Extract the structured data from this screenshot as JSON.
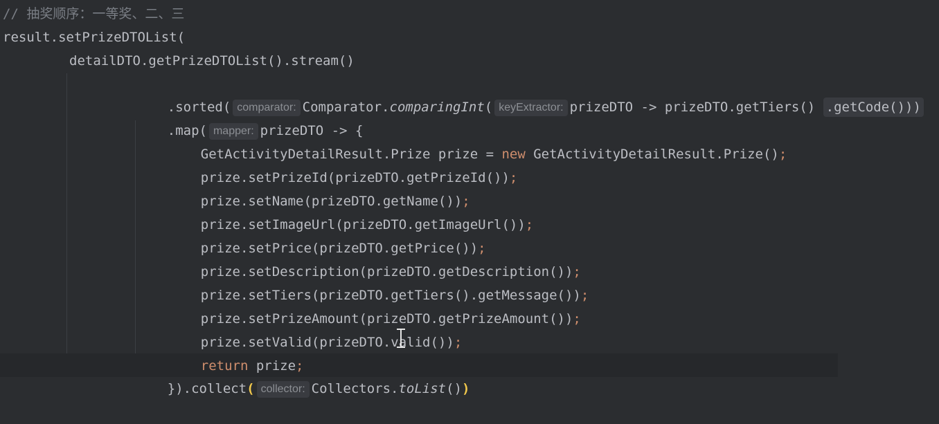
{
  "editor": {
    "lines": [
      {
        "comment": "// 抽奖顺序：一等奖、二、三"
      },
      {
        "code": "result.setPrizeDTOList("
      },
      {
        "code": "detailDTO.getPrizeDTOList().stream()"
      },
      {
        "pre": ".sorted(",
        "hint1": "comparator:",
        "mid1": "Comparator.",
        "ital": "comparingInt",
        "mid2": "(",
        "hint2": "keyExtractor:",
        "mid3": "prizeDTO -> prizeDTO.getTiers()",
        "fold": ".getCode()))"
      },
      {
        "pre": ".map(",
        "hint": "mapper:",
        "post": "prizeDTO -> {"
      },
      {
        "pre": "GetActivityDetailResult.Prize prize = ",
        "kw": "new",
        "post": " GetActivityDetailResult.Prize()",
        "semi": ";"
      },
      {
        "code": "prize.setPrizeId(prizeDTO.getPrizeId())",
        "semi": ";"
      },
      {
        "code": "prize.setName(prizeDTO.getName())",
        "semi": ";"
      },
      {
        "code": "prize.setImageUrl(prizeDTO.getImageUrl())",
        "semi": ";"
      },
      {
        "code": "prize.setPrice(prizeDTO.getPrice())",
        "semi": ";"
      },
      {
        "code": "prize.setDescription(prizeDTO.getDescription())",
        "semi": ";"
      },
      {
        "code": "prize.setTiers(prizeDTO.getTiers().getMessage())",
        "semi": ";"
      },
      {
        "code": "prize.setPrizeAmount(prizeDTO.getPrizeAmount())",
        "semi": ";"
      },
      {
        "code": "prize.setValid(prizeDTO.valid())",
        "semi": ";"
      },
      {
        "kw": "return",
        "post": " prize",
        "semi": ";"
      },
      {
        "pre": "}).collect",
        "paren_open": "(",
        "hint": "collector:",
        "mid": "Collectors.",
        "ital": "toList",
        "post": "()",
        "paren_close": ")"
      }
    ]
  }
}
